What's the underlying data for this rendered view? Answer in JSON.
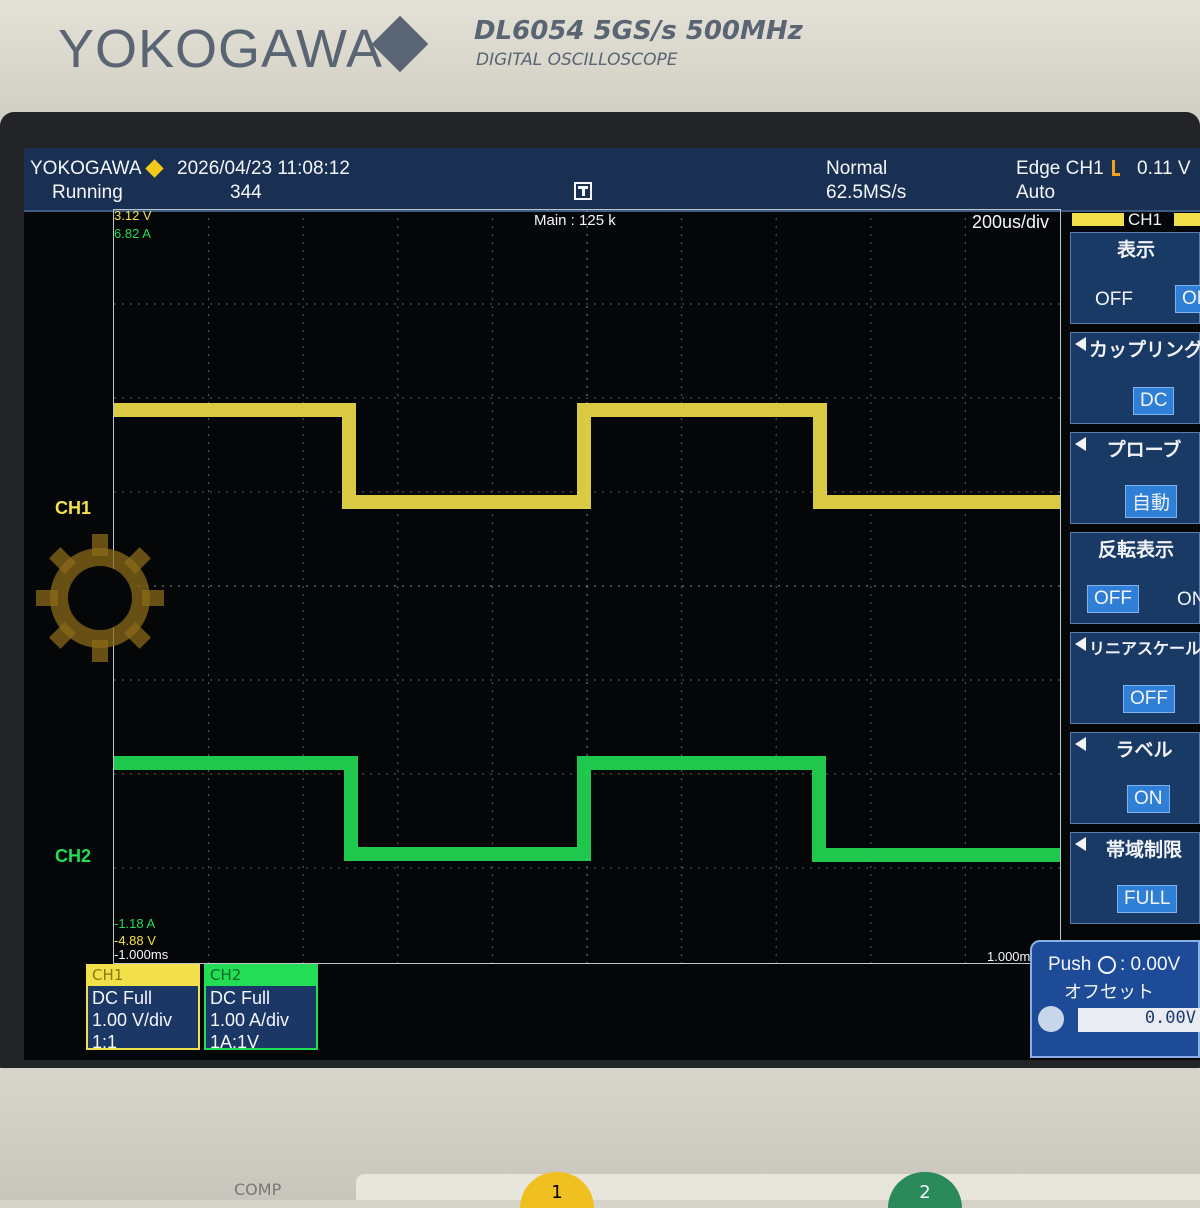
{
  "bezel": {
    "brand": "YOKOGAWA",
    "model": "DL6054  5GS/s 500MHz",
    "model_sub": "DIGITAL OSCILLOSCOPE",
    "bottom_button": "COMP",
    "key1": "1",
    "key2": "2"
  },
  "header": {
    "brand": "YOKOGAWA",
    "datetime": "2026/04/23 11:08:12",
    "status": "Running",
    "count": "344",
    "acq_mode": "Normal",
    "sample_rate": "62.5MS/s",
    "trigger": "Edge CH1",
    "trigger_level": "0.11 V",
    "trigger_mode": "Auto"
  },
  "screen": {
    "main_zoom": "Main : 125 k",
    "timebase": "200us/div",
    "ch1_top": "3.12 V",
    "ch2_top": "6.82 A",
    "ch2_bottom": "-1.18 A",
    "ch1_bottom": "-4.88 V",
    "time_left": "-1.000ms",
    "time_right": "1.000m",
    "ch1_marker": "CH1",
    "ch2_marker": "CH2"
  },
  "side_menu": {
    "channel": "CH1",
    "display": {
      "title": "表示",
      "off": "OFF",
      "on": "ON"
    },
    "coupling": {
      "title": "カップリング",
      "value": "DC"
    },
    "probe": {
      "title": "プローブ",
      "value": "自動"
    },
    "invert": {
      "title": "反転表示",
      "off": "OFF",
      "on": "ON"
    },
    "linear_scale": {
      "title": "リニアスケール",
      "value": "OFF"
    },
    "label": {
      "title": "ラベル",
      "value": "ON"
    },
    "bandwidth": {
      "title": "帯域制限",
      "value": "FULL"
    }
  },
  "channels": [
    {
      "name": "CH1",
      "coupling": "DC Full",
      "scale": "1.00 V/div",
      "probe": "1:1",
      "color": "#f2e04a"
    },
    {
      "name": "CH2",
      "coupling": "DC Full",
      "scale": "1.00 A/div",
      "probe": "1A:1V",
      "color": "#22dd55"
    }
  ],
  "offset": {
    "push_label": "Push",
    "colon_value": ":  0.00V",
    "title": "オフセット",
    "value": "0.00V"
  },
  "colors": {
    "ch1": "#f2e04a",
    "ch2": "#22dd55",
    "header": "#193052",
    "menu": "#1a3a66"
  }
}
